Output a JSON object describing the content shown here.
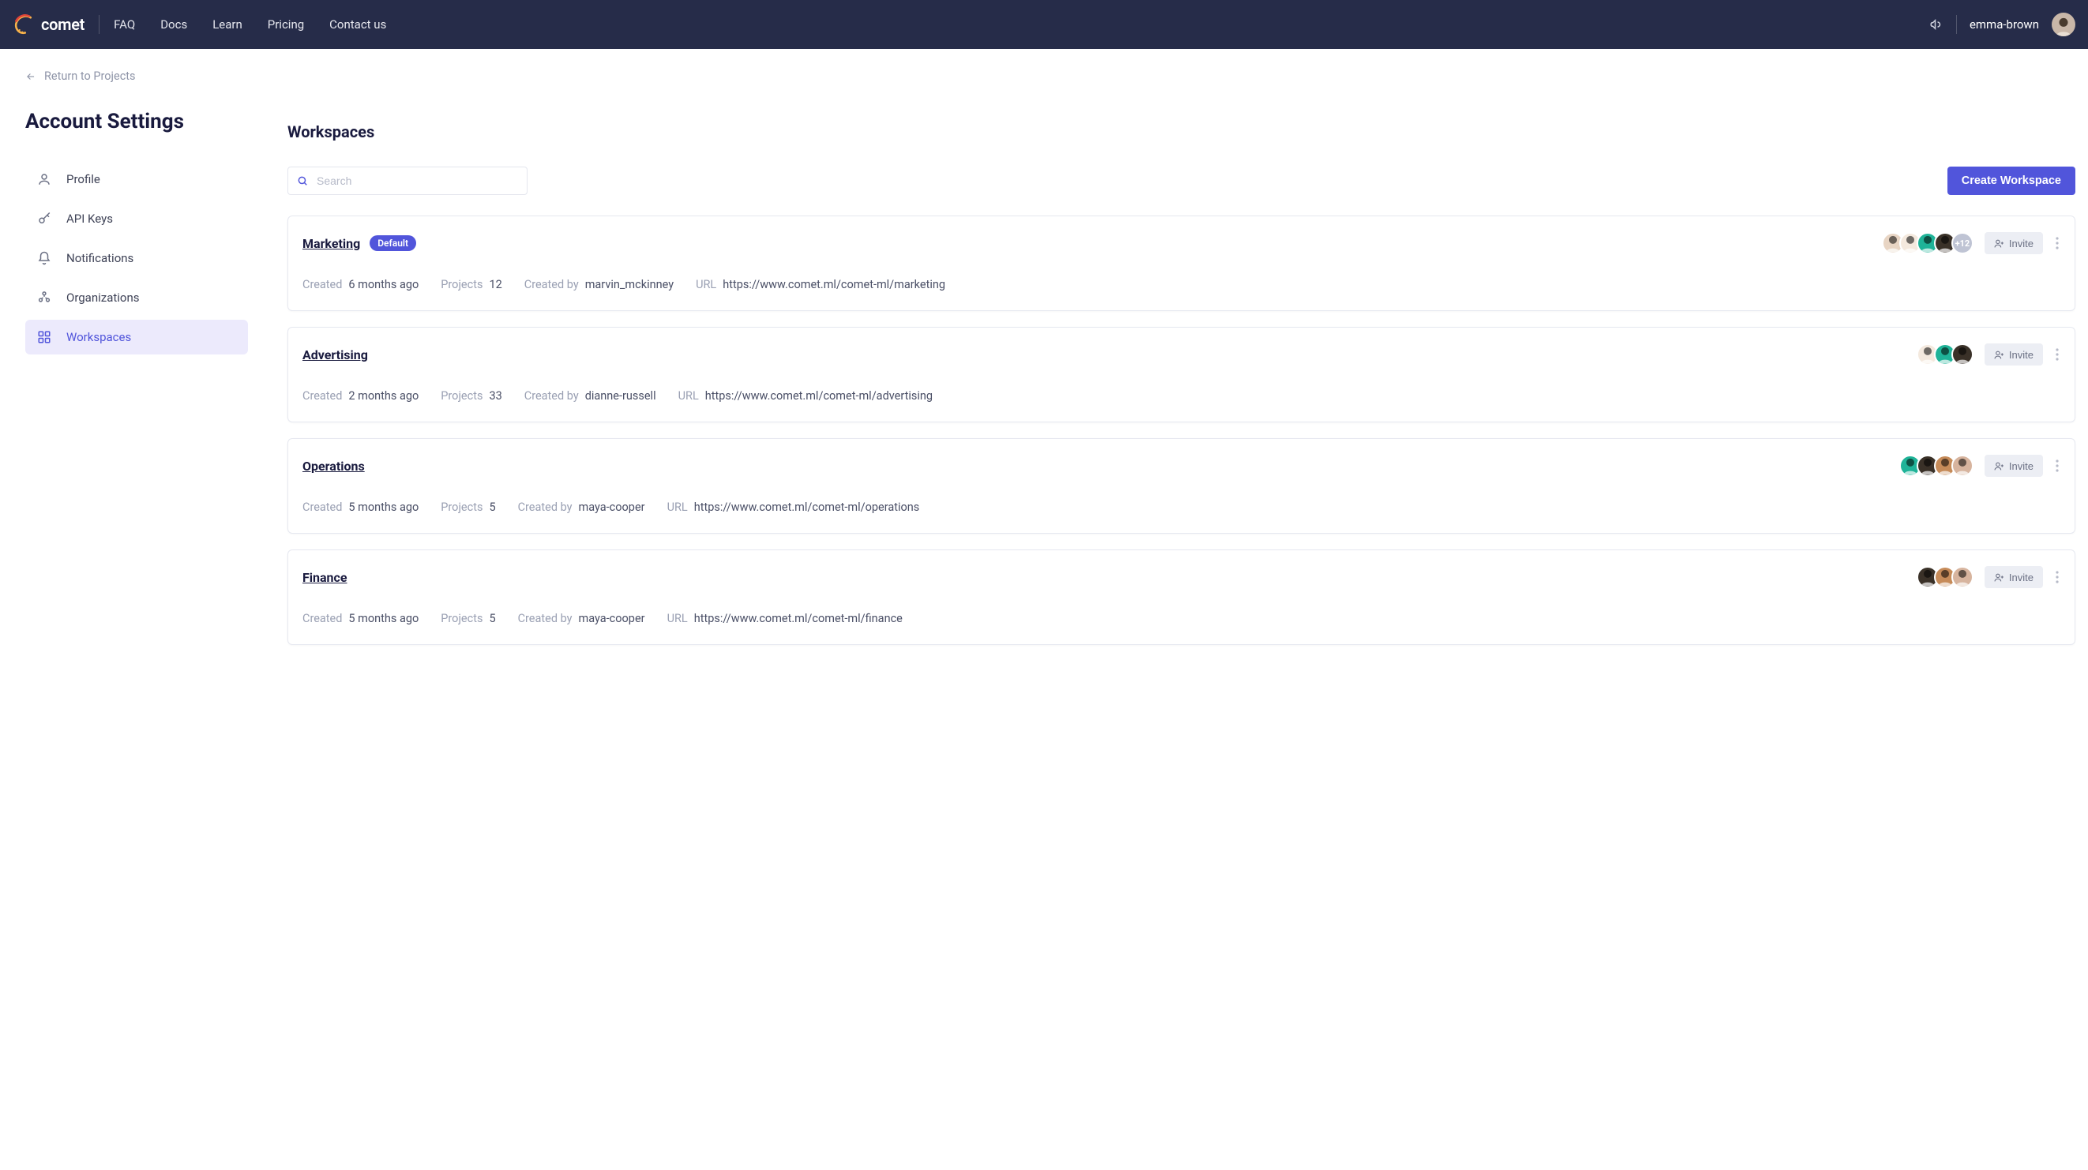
{
  "nav": {
    "brand": "comet",
    "links": [
      "FAQ",
      "Docs",
      "Learn",
      "Pricing",
      "Contact us"
    ],
    "username": "emma-brown"
  },
  "return_link": "Return to Projects",
  "page_title": "Account Settings",
  "sidebar": {
    "items": [
      {
        "label": "Profile",
        "icon": "user"
      },
      {
        "label": "API Keys",
        "icon": "key"
      },
      {
        "label": "Notifications",
        "icon": "bell"
      },
      {
        "label": "Organizations",
        "icon": "org"
      },
      {
        "label": "Workspaces",
        "icon": "grid",
        "active": true
      }
    ]
  },
  "main": {
    "title": "Workspaces",
    "search_placeholder": "Search",
    "create_label": "Create Workspace",
    "invite_label": "Invite",
    "default_label": "Default",
    "meta_labels": {
      "created": "Created",
      "projects": "Projects",
      "created_by": "Created by",
      "url": "URL"
    },
    "workspaces": [
      {
        "name": "Marketing",
        "is_default": true,
        "avatars": 4,
        "more_count": "+12",
        "created": "6 months ago",
        "projects": "12",
        "created_by": "marvin_mckinney",
        "url": "https://www.comet.ml/comet-ml/marketing"
      },
      {
        "name": "Advertising",
        "is_default": false,
        "avatars": 3,
        "more_count": null,
        "created": "2 months ago",
        "projects": "33",
        "created_by": "dianne-russell",
        "url": "https://www.comet.ml/comet-ml/advertising"
      },
      {
        "name": "Operations",
        "is_default": false,
        "avatars": 4,
        "more_count": null,
        "created": "5 months ago",
        "projects": "5",
        "created_by": "maya-cooper",
        "url": "https://www.comet.ml/comet-ml/operations"
      },
      {
        "name": "Finance",
        "is_default": false,
        "avatars": 3,
        "more_count": null,
        "created": "5 months ago",
        "projects": "5",
        "created_by": "maya-cooper",
        "url": "https://www.comet.ml/comet-ml/finance"
      }
    ]
  }
}
